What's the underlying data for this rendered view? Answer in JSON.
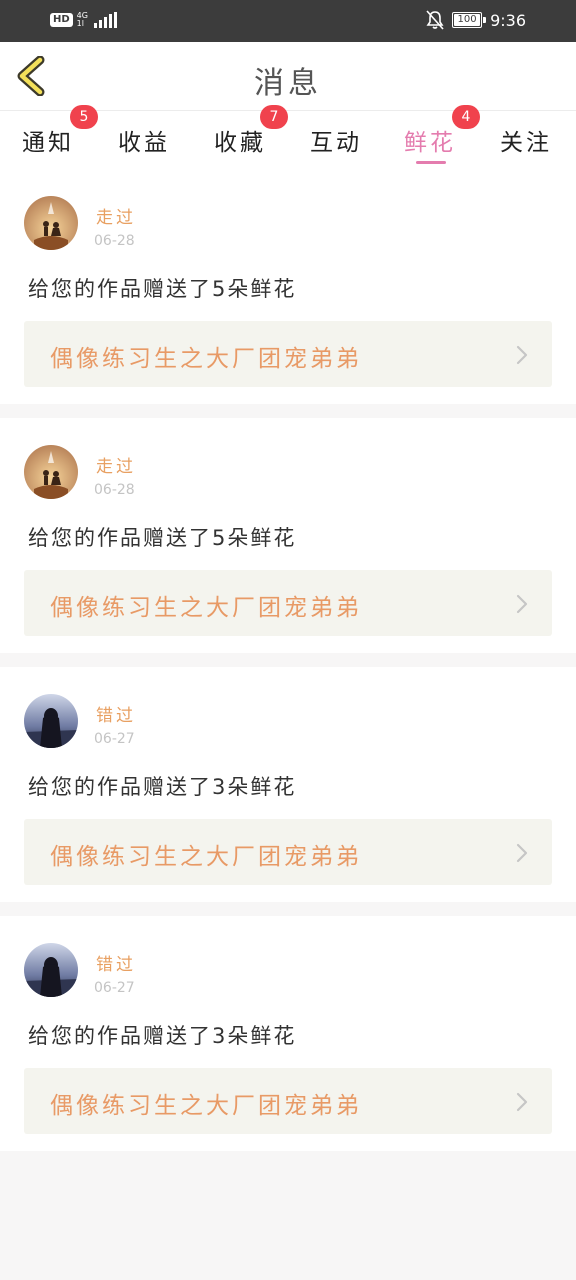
{
  "status_bar": {
    "hd": "HD",
    "network": "4G",
    "network_sub": "1l",
    "battery": "100",
    "time": "9:36"
  },
  "header": {
    "title": "消息",
    "back_icon": "chevron-left-icon"
  },
  "tabs": [
    {
      "label": "通知",
      "badge": "5"
    },
    {
      "label": "收益",
      "badge": ""
    },
    {
      "label": "收藏",
      "badge": "7"
    },
    {
      "label": "互动",
      "badge": ""
    },
    {
      "label": "鲜花",
      "badge": "4",
      "active": true
    },
    {
      "label": "关注",
      "badge": ""
    }
  ],
  "colors": {
    "accent": "#e47cae",
    "badge": "#f0424d",
    "username": "#e8a062",
    "work_title": "#e89a66"
  },
  "messages": [
    {
      "username": "走过",
      "date": "06-28",
      "text": "给您的作品赠送了5朵鲜花",
      "work": "偶像练习生之大厂团宠弟弟",
      "avatar": "couple-silhouette"
    },
    {
      "username": "走过",
      "date": "06-28",
      "text": "给您的作品赠送了5朵鲜花",
      "work": "偶像练习生之大厂团宠弟弟",
      "avatar": "couple-silhouette"
    },
    {
      "username": "错过",
      "date": "06-27",
      "text": "给您的作品赠送了3朵鲜花",
      "work": "偶像练习生之大厂团宠弟弟",
      "avatar": "girl-back-silhouette"
    },
    {
      "username": "错过",
      "date": "06-27",
      "text": "给您的作品赠送了3朵鲜花",
      "work": "偶像练习生之大厂团宠弟弟",
      "avatar": "girl-back-silhouette"
    }
  ]
}
